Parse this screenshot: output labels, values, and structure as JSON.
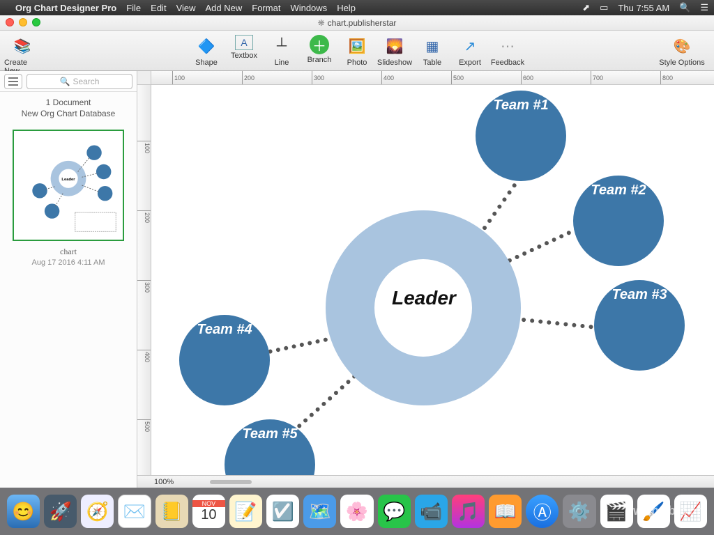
{
  "menubar": {
    "appname": "Org Chart Designer Pro",
    "items": [
      "File",
      "Edit",
      "View",
      "Add New",
      "Format",
      "Windows",
      "Help"
    ],
    "clock": "Thu 7:55 AM"
  },
  "window": {
    "title": "chart.publisherstar"
  },
  "toolbar": {
    "create_new": "Create New",
    "shape": "Shape",
    "textbox": "Textbox",
    "line": "Line",
    "branch": "Branch",
    "photo": "Photo",
    "slideshow": "Slideshow",
    "table": "Table",
    "export": "Export",
    "feedback": "Feedback",
    "style_options": "Style Options"
  },
  "sidebar": {
    "search_placeholder": "Search",
    "doc_count": "1 Document",
    "db_name": "New Org Chart Database",
    "thumb_name": "chart",
    "thumb_date": "Aug 17 2016 4:11 AM"
  },
  "status": {
    "zoom": "100%"
  },
  "ruler": {
    "h": [
      "100",
      "200",
      "300",
      "400",
      "500",
      "600",
      "700",
      "800"
    ],
    "v": [
      "100",
      "200",
      "300",
      "400",
      "500"
    ]
  },
  "chart": {
    "center": "Leader",
    "nodes": [
      "Team #1",
      "Team #2",
      "Team #3",
      "Team #4",
      "Team #5"
    ]
  },
  "watermark": "wkhub.com"
}
